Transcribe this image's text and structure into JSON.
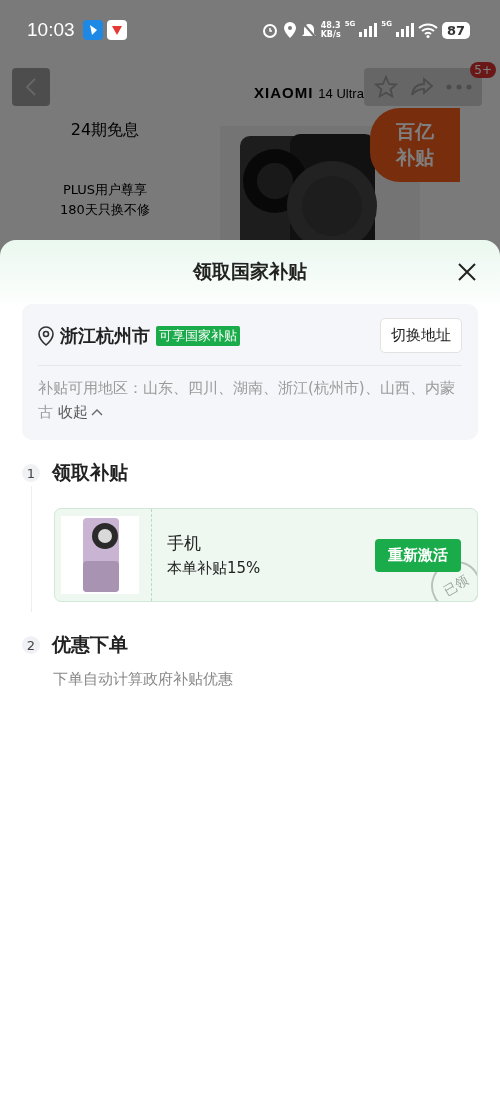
{
  "status_bar": {
    "time": "10:03",
    "net_speed": "48.3",
    "net_unit": "KB/s",
    "signal_labels": [
      "5G",
      "5G"
    ],
    "battery": "87"
  },
  "background_page": {
    "badge": "5+",
    "brand": "XIAOMI",
    "model": "14 Ultra",
    "promo_title": "24期免息",
    "promo_lines": [
      "PLUS用户尊享",
      "180天只换不修"
    ],
    "subsidy_badge": [
      "百亿",
      "补贴"
    ]
  },
  "sheet": {
    "title": "领取国家补贴",
    "location": {
      "city": "浙江杭州市",
      "tag": "可享国家补贴",
      "button": "切换地址",
      "regions": "补贴可用地区：山东、四川、湖南、浙江(杭州市)、山西、内蒙古",
      "toggle": "收起",
      "expanded": true
    },
    "steps": [
      {
        "number": "1",
        "title": "领取补贴",
        "coupon": {
          "name": "手机",
          "rate": "本单补贴15%",
          "button": "重新激活",
          "stamp": "已领",
          "claimed": true
        }
      },
      {
        "number": "2",
        "title": "优惠下单",
        "note": "下单自动计算政府补贴优惠"
      }
    ]
  }
}
